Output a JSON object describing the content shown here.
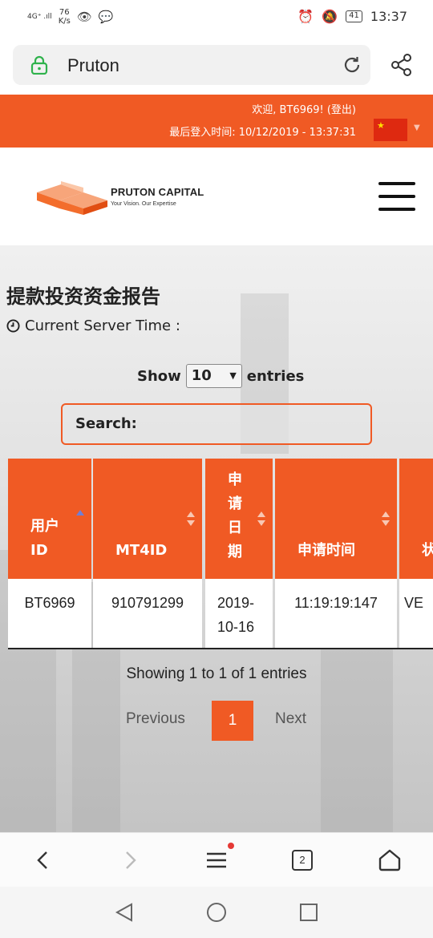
{
  "status_bar": {
    "signal": "4G⁺ .ıll",
    "speed_value": "76",
    "speed_unit": "K/s",
    "battery": "41",
    "time": "13:37"
  },
  "browser": {
    "address_text": "Pruton",
    "tab_count": "2"
  },
  "banner": {
    "welcome": "欢迎, BT6969! (登出)",
    "last_login": "最后登入时间: 10/12/2019 - 13:37:31"
  },
  "logo": {
    "name": "PRUTON CAPITAL",
    "tagline": "Your Vision. Our Expertise"
  },
  "page": {
    "title": "提款投资资金报告",
    "server_time_label": "Current Server Time :",
    "show_label": "Show",
    "entries_label": "entries",
    "page_length": "10",
    "search_label": "Search:"
  },
  "table": {
    "columns": [
      "用户 ID",
      "MT4ID",
      "申请日期",
      "申请时间",
      "状"
    ],
    "rows": [
      [
        "BT6969",
        "910791299",
        "2019-10-16",
        "11:19:19:147",
        "VE"
      ]
    ]
  },
  "pagination": {
    "info": "Showing 1 to 1 of 1 entries",
    "previous": "Previous",
    "current": "1",
    "next": "Next"
  },
  "colors": {
    "accent": "#f05a24",
    "flag_red": "#de2910",
    "flag_star": "#ffde00"
  },
  "icons": {
    "address": [
      "lock-icon",
      "reload-icon",
      "share-icon"
    ],
    "browser_bar": [
      "back-icon",
      "forward-icon",
      "menu-icon",
      "tabs-icon",
      "home-icon"
    ],
    "system_nav": [
      "back-triangle-icon",
      "home-circle-icon",
      "recents-square-icon"
    ]
  }
}
